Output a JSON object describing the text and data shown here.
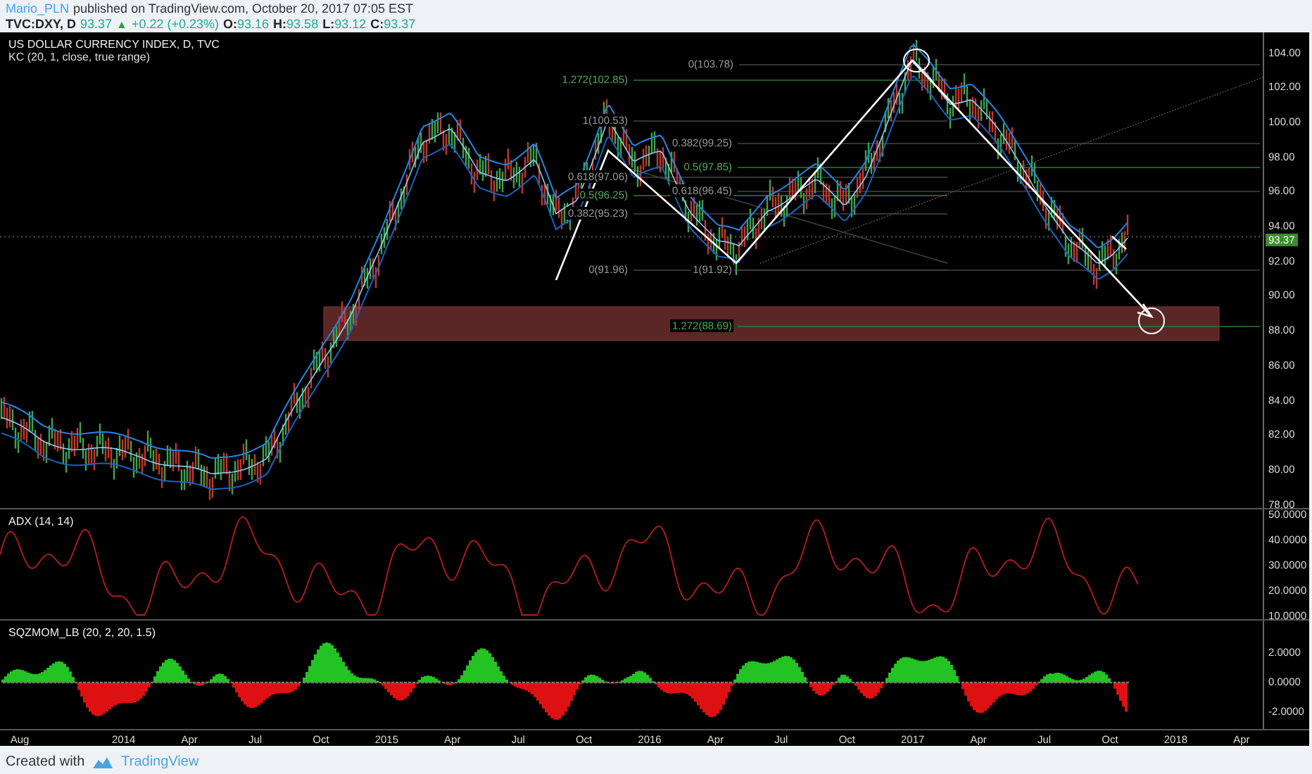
{
  "header": {
    "author": "Mario_PLN",
    "published": "published on TradingView.com, October 20, 2017 07:05 EST"
  },
  "quote": {
    "symbol": "TVC:DXY, D",
    "last": "93.37",
    "arrow": "▲",
    "change": "+0.22 (+0.23%)",
    "fields": [
      {
        "label": "O:",
        "value": "93.16"
      },
      {
        "label": "H:",
        "value": "93.58"
      },
      {
        "label": "L:",
        "value": "93.12"
      },
      {
        "label": "C:",
        "value": "93.37"
      }
    ]
  },
  "price_pane": {
    "title": "US DOLLAR CURRENCY INDEX, D, TVC",
    "indicator": "KC (20, 1, close, true range)",
    "fib_labels": [
      {
        "text": "0(103.78)",
        "kind": "retracement"
      },
      {
        "text": "1.272(102.85)",
        "kind": "extension"
      },
      {
        "text": "1(100.53)",
        "kind": "retracement"
      },
      {
        "text": "0.382(99.25)",
        "kind": "retracement"
      },
      {
        "text": "0.5(97.85)",
        "kind": "extension"
      },
      {
        "text": "0.618(97.06)",
        "kind": "retracement"
      },
      {
        "text": "0.5(96.25)",
        "kind": "extension"
      },
      {
        "text": "0.618(96.45)",
        "kind": "retracement"
      },
      {
        "text": "0.382(95.23)",
        "kind": "retracement"
      },
      {
        "text": "0(91.96)",
        "kind": "retracement"
      },
      {
        "text": "1(91.92)",
        "kind": "retracement"
      },
      {
        "text": "1.272(88.69)",
        "kind": "extension"
      }
    ],
    "axis_labels": [
      "104.00",
      "102.00",
      "100.00",
      "98.00",
      "96.00",
      "94.00",
      "92.00",
      "90.00",
      "88.00",
      "86.00",
      "84.00",
      "82.00",
      "80.00",
      "78.00"
    ],
    "last_price": "93.37"
  },
  "adx_pane": {
    "title": "ADX (14, 14)",
    "axis_labels": [
      "50.0000",
      "40.0000",
      "30.0000",
      "20.0000",
      "10.0000"
    ]
  },
  "sqz_pane": {
    "title": "SQZMOM_LB (20, 2, 20, 1.5)",
    "axis_labels": [
      "2.0000",
      "0.0000",
      "-2.0000"
    ]
  },
  "time_axis": {
    "labels": [
      "Aug",
      "2014",
      "Apr",
      "Jul",
      "Oct",
      "2015",
      "Apr",
      "Jul",
      "Oct",
      "2016",
      "Apr",
      "Jul",
      "Oct",
      "2017",
      "Apr",
      "Jul",
      "Oct",
      "2018",
      "Apr"
    ]
  },
  "footer": {
    "text": "Created with",
    "brand": "TradingView"
  }
}
